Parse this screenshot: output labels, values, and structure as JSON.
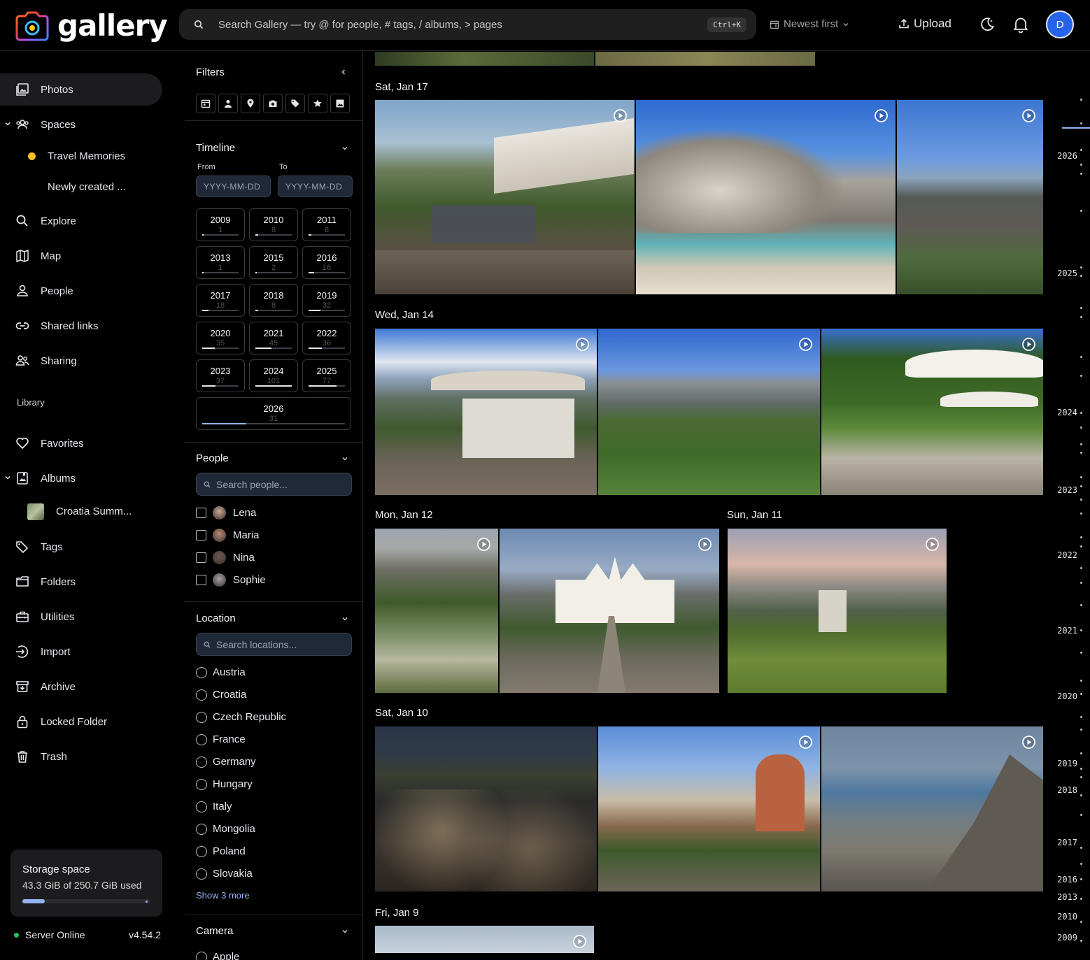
{
  "header": {
    "logo_text": "gallery",
    "search_placeholder": "Search Gallery — try @ for people, # tags, / albums, > pages",
    "search_shortcut": "Ctrl+K",
    "sort_label": "Newest first",
    "upload_label": "Upload",
    "avatar_initial": "D"
  },
  "nav": {
    "photos": "Photos",
    "spaces": "Spaces",
    "space_travel": "Travel Memories",
    "space_new": "Newly created ...",
    "explore": "Explore",
    "map": "Map",
    "people": "People",
    "shared_links": "Shared links",
    "sharing": "Sharing",
    "library_heading": "Library",
    "favorites": "Favorites",
    "albums": "Albums",
    "album_croatia": "Croatia Summ...",
    "tags": "Tags",
    "folders": "Folders",
    "utilities": "Utilities",
    "import": "Import",
    "archive": "Archive",
    "locked_folder": "Locked Folder",
    "trash": "Trash"
  },
  "storage": {
    "title": "Storage space",
    "usage": "43.3 GiB of 250.7 GiB used",
    "used_fraction": 0.173
  },
  "server": {
    "status": "Server Online",
    "version": "v4.54.2"
  },
  "filters": {
    "title": "Filters",
    "timeline": {
      "title": "Timeline",
      "from_label": "From",
      "to_label": "To",
      "from_placeholder": "YYYY-MM-DD",
      "to_placeholder": "YYYY-MM-DD",
      "years": [
        {
          "year": "2009",
          "count": "1",
          "fraction": 0.01
        },
        {
          "year": "2010",
          "count": "8",
          "fraction": 0.08
        },
        {
          "year": "2011",
          "count": "8",
          "fraction": 0.08
        },
        {
          "year": "2013",
          "count": "1",
          "fraction": 0.01
        },
        {
          "year": "2015",
          "count": "2",
          "fraction": 0.02
        },
        {
          "year": "2016",
          "count": "16",
          "fraction": 0.16
        },
        {
          "year": "2017",
          "count": "18",
          "fraction": 0.18
        },
        {
          "year": "2018",
          "count": "8",
          "fraction": 0.08
        },
        {
          "year": "2019",
          "count": "32",
          "fraction": 0.32
        },
        {
          "year": "2020",
          "count": "35",
          "fraction": 0.35
        },
        {
          "year": "2021",
          "count": "45",
          "fraction": 0.45
        },
        {
          "year": "2022",
          "count": "36",
          "fraction": 0.36
        },
        {
          "year": "2023",
          "count": "37",
          "fraction": 0.37
        },
        {
          "year": "2024",
          "count": "101",
          "fraction": 1.0
        },
        {
          "year": "2025",
          "count": "77",
          "fraction": 0.76
        },
        {
          "year": "2026",
          "count": "31",
          "fraction": 0.31
        }
      ]
    },
    "people": {
      "title": "People",
      "search_placeholder": "Search people...",
      "items": [
        "Lena",
        "Maria",
        "Nina",
        "Sophie"
      ]
    },
    "location": {
      "title": "Location",
      "search_placeholder": "Search locations...",
      "items": [
        "Austria",
        "Croatia",
        "Czech Republic",
        "France",
        "Germany",
        "Hungary",
        "Italy",
        "Mongolia",
        "Poland",
        "Slovakia"
      ],
      "show_more": "Show 3 more"
    },
    "camera": {
      "title": "Camera",
      "first_item": "Apple"
    }
  },
  "timeline_groups": [
    {
      "date": "Sat, Jan 17"
    },
    {
      "date": "Wed, Jan 14"
    },
    {
      "date": "Mon, Jan 12"
    },
    {
      "date": "Sun, Jan 11"
    },
    {
      "date": "Sat, Jan 10"
    },
    {
      "date": "Fri, Jan 9"
    }
  ],
  "scrubber_years": [
    "2026",
    "2025",
    "2024",
    "2023",
    "2022",
    "2021",
    "2020",
    "2019",
    "2018",
    "2017",
    "2016",
    "2013",
    "2010",
    "2009"
  ],
  "colors": {
    "accent": "#93b4f5",
    "avatar_bg": "#2563eb",
    "server_online": "#22c55e",
    "space_dot": "#fbbf24"
  }
}
